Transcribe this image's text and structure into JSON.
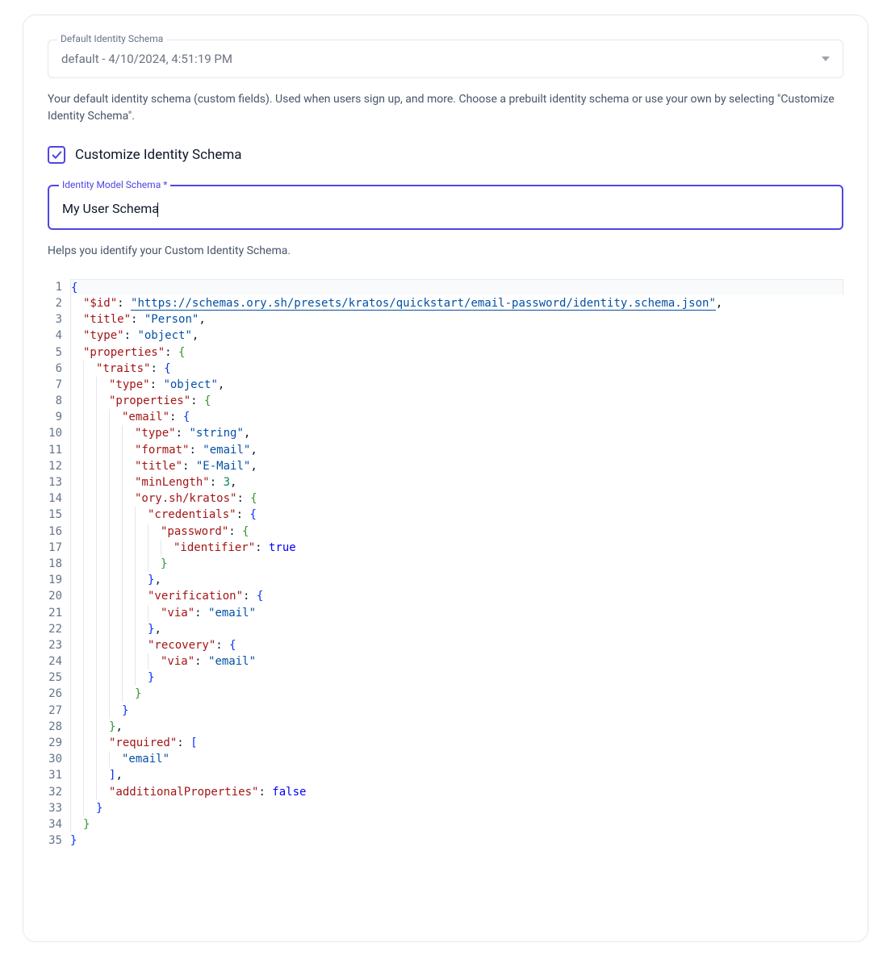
{
  "schemaSelect": {
    "label": "Default Identity Schema",
    "value": "default - 4/10/2024, 4:51:19 PM",
    "helper": "Your default identity schema (custom fields). Used when users sign up, and more. Choose a prebuilt identity schema or use your own by selecting \"Customize Identity Schema\"."
  },
  "customize": {
    "label": "Customize Identity Schema",
    "checked": true
  },
  "nameField": {
    "label": "Identity Model Schema *",
    "value": "My User Schema",
    "helper": "Helps you identify your Custom Identity Schema."
  },
  "code": {
    "id_key": "\"$id\"",
    "id_val": "\"https://schemas.ory.sh/presets/kratos/quickstart/email-password/identity.schema.json\"",
    "title_key": "\"title\"",
    "title_val": "\"Person\"",
    "type_key": "\"type\"",
    "type_obj": "\"object\"",
    "properties_key": "\"properties\"",
    "traits_key": "\"traits\"",
    "type_obj2": "\"object\"",
    "email_key": "\"email\"",
    "type_string": "\"string\"",
    "format_key": "\"format\"",
    "format_email": "\"email\"",
    "title_email": "\"E-Mail\"",
    "minlength_key": "\"minLength\"",
    "minlength_val": "3",
    "orykratos_key": "\"ory.sh/kratos\"",
    "credentials_key": "\"credentials\"",
    "password_key": "\"password\"",
    "identifier_key": "\"identifier\"",
    "true_val": "true",
    "verification_key": "\"verification\"",
    "via_key": "\"via\"",
    "via_email": "\"email\"",
    "recovery_key": "\"recovery\"",
    "required_key": "\"required\"",
    "required_item": "\"email\"",
    "addprops_key": "\"additionalProperties\"",
    "false_val": "false",
    "line_count": 35
  }
}
